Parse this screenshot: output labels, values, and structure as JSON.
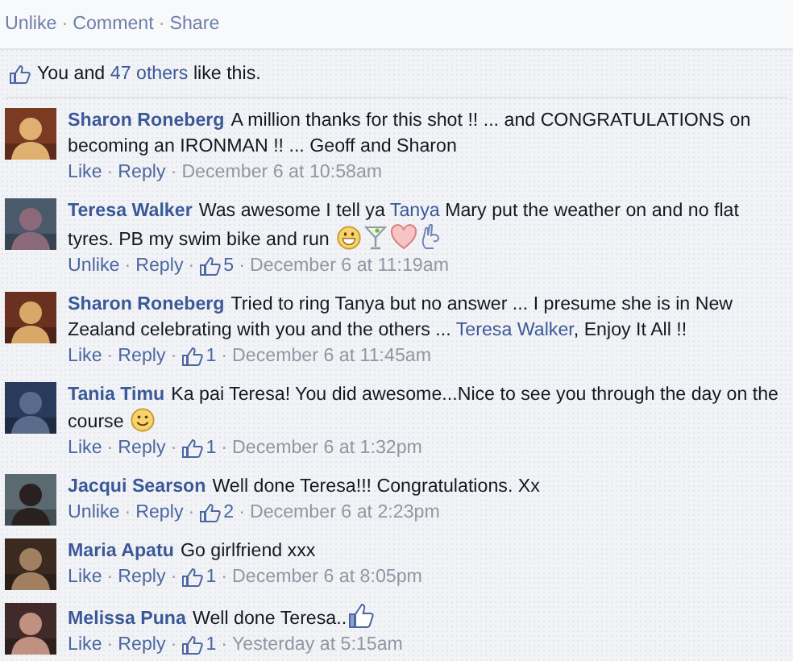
{
  "separator": "·",
  "post_actions": [
    "Unlike",
    "Comment",
    "Share"
  ],
  "likes_summary": {
    "prefix": "You and",
    "link": "47 others",
    "suffix": "like this."
  },
  "comments": [
    {
      "author": "Sharon Roneberg",
      "parts": [
        {
          "kind": "text",
          "text": "A million thanks for this shot !! ... and CONGRATULATIONS on becoming an IRONMAN !! ... Geoff and Sharon"
        }
      ],
      "action": "Like",
      "reply": "Reply",
      "time": "December 6 at 10:58am"
    },
    {
      "author": "Teresa Walker",
      "parts": [
        {
          "kind": "text",
          "text": "Was awesome I tell ya"
        },
        {
          "kind": "link",
          "text": "Tanya"
        },
        {
          "kind": "text",
          "text": "Mary put the weather on and no flat tyres. PB my swim bike and run"
        },
        {
          "kind": "grin"
        },
        {
          "kind": "cocktail"
        },
        {
          "kind": "heart"
        },
        {
          "kind": "ok-hand"
        }
      ],
      "action": "Unlike",
      "reply": "Reply",
      "likes": "5",
      "time": "December 6 at 11:19am"
    },
    {
      "author": "Sharon Roneberg",
      "parts": [
        {
          "kind": "text",
          "text": "Tried to ring Tanya but no answer ... I presume she is in New Zealand celebrating with you and the others ..."
        },
        {
          "kind": "link",
          "text": "Teresa Walker"
        },
        {
          "kind": "tail",
          "text": ", Enjoy It All !!"
        }
      ],
      "action": "Like",
      "reply": "Reply",
      "likes": "1",
      "time": "December 6 at 11:45am"
    },
    {
      "author": "Tania Timu",
      "parts": [
        {
          "kind": "text",
          "text": "Ka pai Teresa! You did awesome...Nice to see you through the day on the course"
        },
        {
          "kind": "smile"
        }
      ],
      "action": "Like",
      "reply": "Reply",
      "likes": "1",
      "time": "December 6 at 1:32pm"
    },
    {
      "author": "Jacqui Searson",
      "parts": [
        {
          "kind": "text",
          "text": "Well done Teresa!!! Congratulations. Xx"
        }
      ],
      "action": "Unlike",
      "reply": "Reply",
      "likes": "2",
      "time": "December 6 at 2:23pm"
    },
    {
      "author": "Maria Apatu",
      "parts": [
        {
          "kind": "text",
          "text": "Go girlfriend xxx"
        }
      ],
      "action": "Like",
      "reply": "Reply",
      "likes": "1",
      "time": "December 6 at 8:05pm"
    },
    {
      "author": "Melissa Puna",
      "parts": [
        {
          "kind": "tail",
          "text": "Well done Teresa.."
        },
        {
          "kind": "like"
        }
      ],
      "action": "Like",
      "reply": "Reply",
      "likes": "1",
      "time": "Yesterday at 5:15am"
    }
  ]
}
